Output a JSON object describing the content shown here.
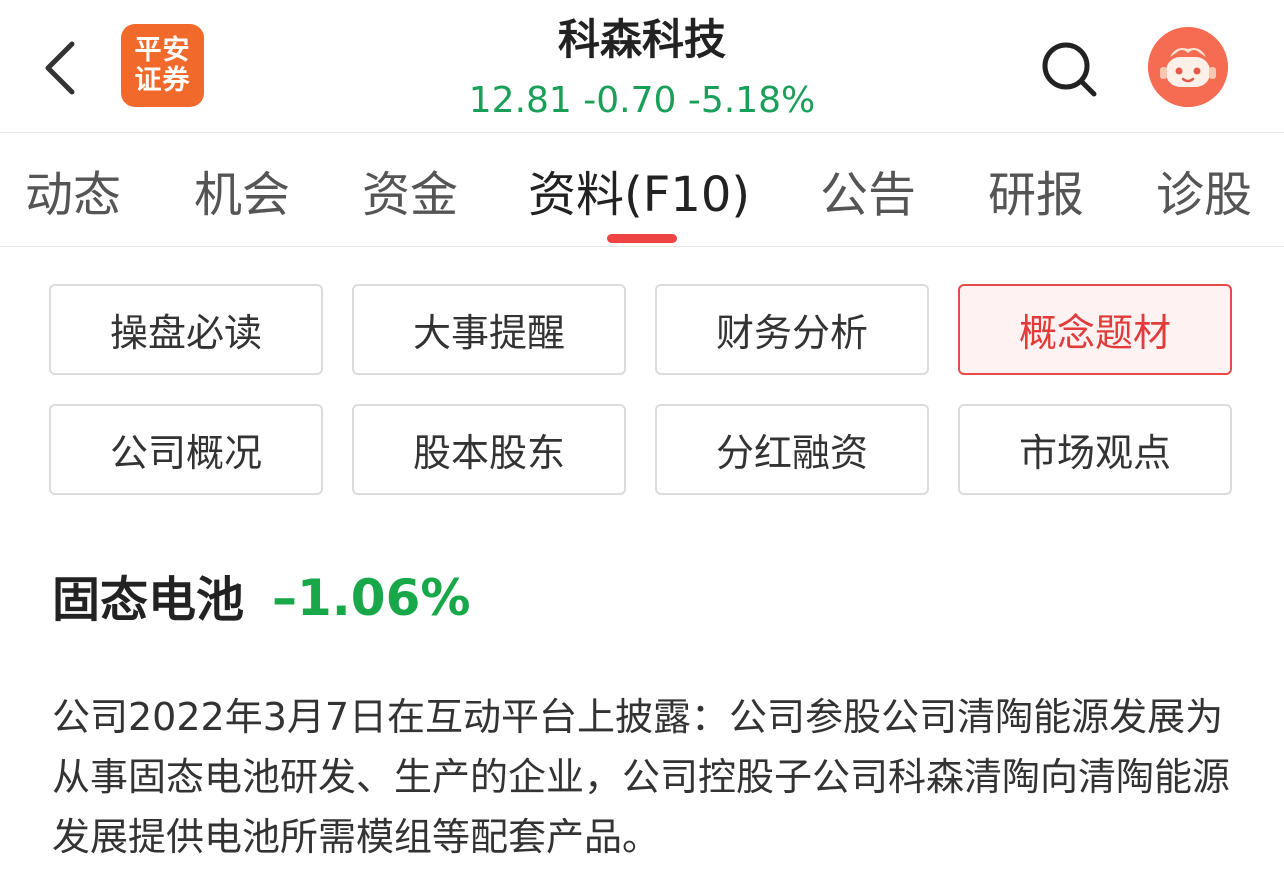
{
  "header": {
    "logo_line1": "平安",
    "logo_line2": "证券",
    "title": "科森科技",
    "quote": "12.81 -0.70 -5.18%",
    "quote_color": "#18a058"
  },
  "tabs": [
    {
      "label": "动态"
    },
    {
      "label": "机会"
    },
    {
      "label": "资金"
    },
    {
      "label": "资料(F10)"
    },
    {
      "label": "公告"
    },
    {
      "label": "研报"
    },
    {
      "label": "诊股"
    }
  ],
  "active_tab": "资料(F10)",
  "accent_color": "#ee4444",
  "sections": [
    {
      "label": "操盘必读"
    },
    {
      "label": "大事提醒"
    },
    {
      "label": "财务分析"
    },
    {
      "label": "概念题材"
    },
    {
      "label": "公司概况"
    },
    {
      "label": "股本股东"
    },
    {
      "label": "分红融资"
    },
    {
      "label": "市场观点"
    }
  ],
  "active_section": "概念题材",
  "concept": {
    "name": "固态电池",
    "change": "–1.06%",
    "change_color": "#18a84a",
    "description": "公司2022年3月7日在互动平台上披露：公司参股公司清陶能源发展为从事固态电池研发、生产的企业，公司控股子公司科森清陶向清陶能源发展提供电池所需模组等配套产品。"
  },
  "icons": {
    "back": "chevron-left-icon",
    "search": "search-icon",
    "assistant": "assistant-avatar-icon"
  }
}
